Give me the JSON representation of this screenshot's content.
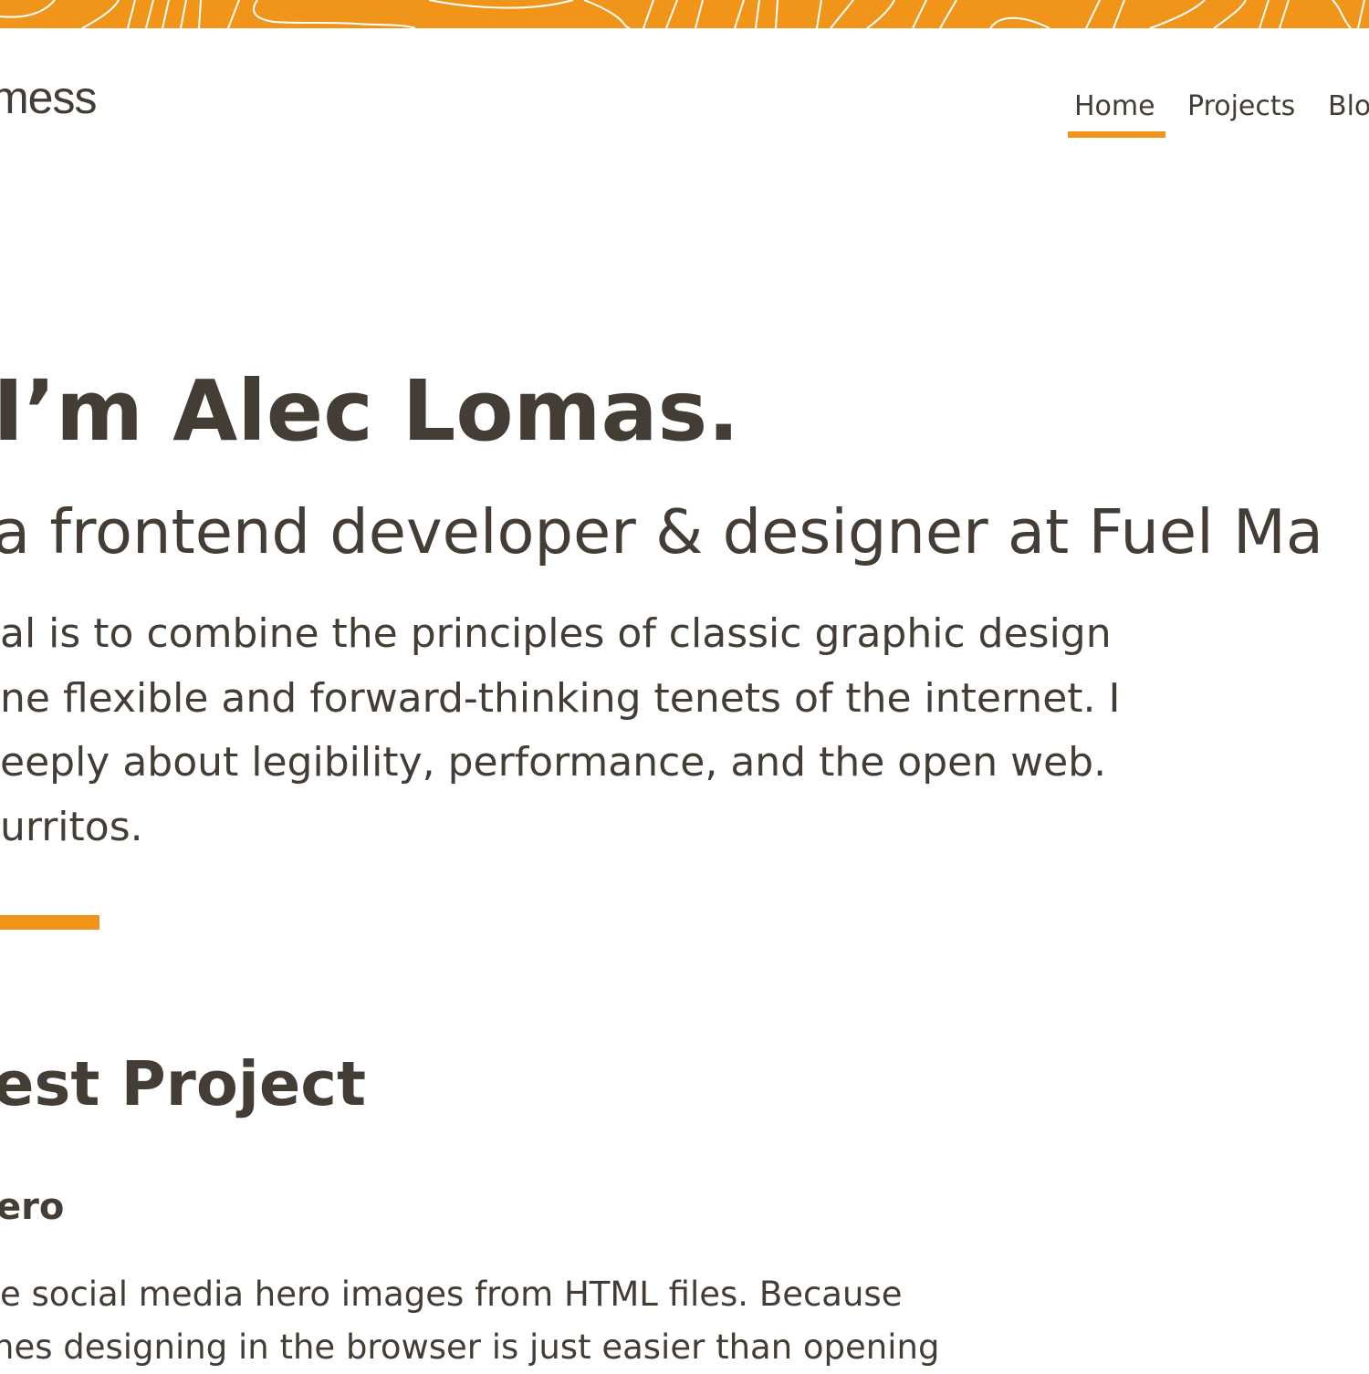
{
  "colors": {
    "accent": "#f0941a",
    "text": "#433d35",
    "background": "#ffffff"
  },
  "header": {
    "logo_text": "mess",
    "nav": [
      {
        "label": "Home",
        "active": true
      },
      {
        "label": "Projects",
        "active": false
      },
      {
        "label": "Blo",
        "active": false
      }
    ]
  },
  "hero": {
    "title": "I’m Alec Lomas.",
    "subtitle": "a frontend developer & designer at Fuel Ma",
    "bio_lines": [
      "al is to combine the principles of classic graphic design",
      "ne flexible and forward-thinking tenets of the internet. I",
      "eeply about legibility, performance, and the open web.",
      "urritos."
    ]
  },
  "latest_project": {
    "section_title": "est Project",
    "name": "ero",
    "description_lines": [
      "e social media hero images from HTML files. Because",
      "nes designing in the browser is just easier than opening"
    ]
  }
}
